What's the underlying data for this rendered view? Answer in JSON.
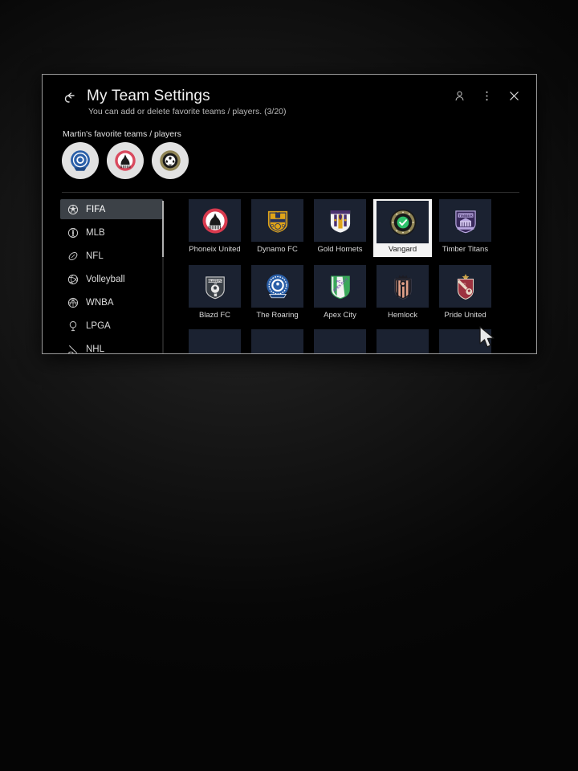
{
  "header": {
    "back_icon": "back-arrow-icon",
    "title": "My Team Settings",
    "subtitle": "You can add or delete favorite teams / players. (3/20)",
    "icons": [
      {
        "name": "account-icon",
        "glyph": "person"
      },
      {
        "name": "more-options-icon",
        "glyph": "kebab"
      },
      {
        "name": "close-icon",
        "glyph": "x"
      }
    ]
  },
  "favorites": {
    "label": "Martin's favorite teams / players",
    "count": "3/20",
    "items": [
      {
        "name": "The Roaring",
        "color": "#2a5fa8",
        "type": "circle-blue"
      },
      {
        "name": "Phoneix United",
        "color": "#d94a5e",
        "type": "circle-red"
      },
      {
        "name": "Vangard",
        "color": "#8f8455",
        "type": "circle-gold"
      }
    ]
  },
  "sidebar": {
    "selected": "FIFA",
    "items": [
      {
        "label": "FIFA",
        "icon": "soccer-ball-icon",
        "selected": true
      },
      {
        "label": "MLB",
        "icon": "baseball-icon",
        "selected": false
      },
      {
        "label": "NFL",
        "icon": "football-icon",
        "selected": false
      },
      {
        "label": "Volleyball",
        "icon": "volleyball-icon",
        "selected": false
      },
      {
        "label": "WNBA",
        "icon": "basketball-icon",
        "selected": false
      },
      {
        "label": "LPGA",
        "icon": "golf-tee-icon",
        "selected": false
      },
      {
        "label": "NHL",
        "icon": "hockey-icon",
        "selected": false
      }
    ]
  },
  "teams": {
    "focused": "Vangard",
    "rows": [
      [
        {
          "name": "Phoneix United",
          "crest": "phoenix",
          "primary": "#d93a4e",
          "secondary": "#ffffff",
          "focused": false
        },
        {
          "name": "Dynamo FC",
          "crest": "dynamo",
          "primary": "#e0a418",
          "secondary": "#24305a",
          "focused": false
        },
        {
          "name": "Gold Hornets",
          "crest": "hornets",
          "primary": "#f0f0f0",
          "secondary": "#4a2f6e",
          "focused": false
        },
        {
          "name": "Vangard",
          "crest": "vangard",
          "primary": "#8f8455",
          "secondary": "#2ec16b",
          "focused": true
        },
        {
          "name": "Timber Titans",
          "crest": "timber",
          "primary": "#b9a8e0",
          "secondary": "#3a2a5c",
          "focused": false
        }
      ],
      [
        {
          "name": "Blazd FC",
          "crest": "blazd",
          "primary": "#d8d8d8",
          "secondary": "#3a4047",
          "focused": false
        },
        {
          "name": "The Roaring",
          "crest": "roaring",
          "primary": "#2a5fa8",
          "secondary": "#ffffff",
          "focused": false
        },
        {
          "name": "Apex City",
          "crest": "apex",
          "primary": "#3aa85a",
          "secondary": "#ffffff",
          "focused": false
        },
        {
          "name": "Hemlock",
          "crest": "hemlock",
          "primary": "#e0a088",
          "secondary": "#1c1c24",
          "focused": false
        },
        {
          "name": "Pride United",
          "crest": "pride",
          "primary": "#9c3240",
          "secondary": "#e8d8c8",
          "focused": false
        }
      ]
    ]
  },
  "colors": {
    "window_border": "#9a9a9a",
    "tile_bg": "#1b2231",
    "sidebar_selected_bg": "#3c4147",
    "focus_outline": "#f4f4f4",
    "text_primary": "#f2f2f2",
    "text_secondary": "#b9b9b9"
  }
}
